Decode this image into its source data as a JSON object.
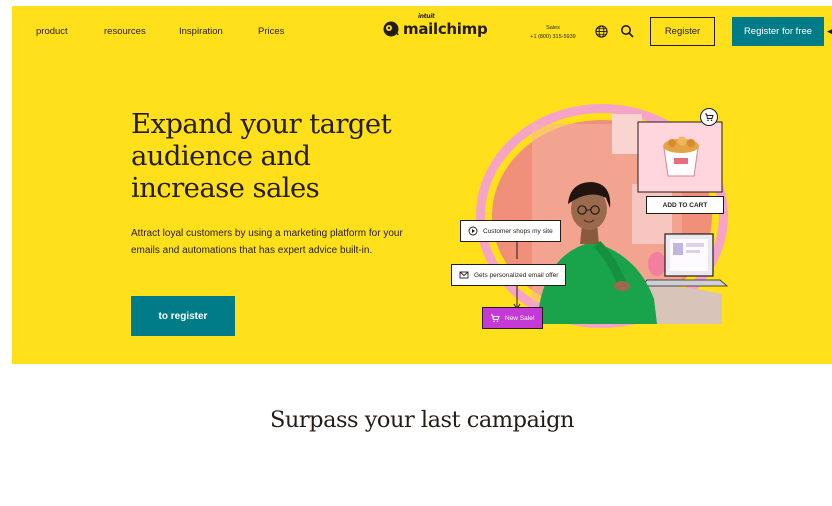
{
  "nav": {
    "items": [
      "product",
      "resources",
      "Inspiration",
      "Prices"
    ],
    "logo_brand": "mailchimp",
    "logo_parent": "intuit",
    "sales_label": "Sales",
    "sales_phone": "+1 (800) 315-5939",
    "register_label": "Register",
    "register_free_label": "Register for free"
  },
  "hero": {
    "title_lines": [
      "Expand your target",
      "audience and",
      "increase sales"
    ],
    "description": "Attract loyal customers by using a marketing platform for your emails and automations that has expert advice built-in.",
    "cta_label": "to register",
    "illustration": {
      "add_to_cart": "ADD TO CART",
      "step1": "Customer shops my site",
      "step2": "Gets personalized email offer",
      "step3": "New Sale!"
    }
  },
  "section": {
    "title": "Surpass your last campaign"
  },
  "icons": {
    "logo": "mailchimp-freddie-icon",
    "globe": "globe-icon",
    "search": "search-icon",
    "cart": "cart-icon",
    "play": "play-icon",
    "email": "email-icon"
  },
  "colors": {
    "brand_yellow": "#ffe01b",
    "teal": "#007c89",
    "ink": "#241c15",
    "sale_purple": "#c53ad6",
    "coral": "#f0907a",
    "pink_ring": "#f5a3c7"
  }
}
